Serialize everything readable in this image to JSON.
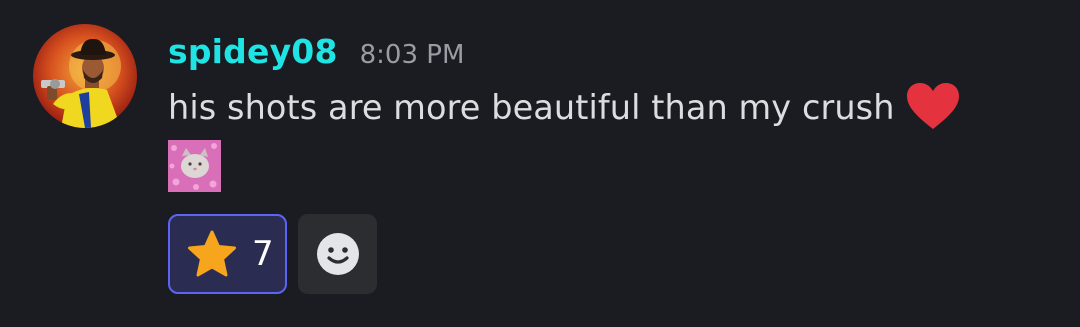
{
  "message": {
    "username": "spidey08",
    "timestamp": "8:03 PM",
    "text": "his shots are more beautiful than my crush",
    "inline_emoji": "red-heart-icon",
    "avatar": "avatar",
    "sticker": "cat-sticker"
  },
  "reactions": [
    {
      "emoji": "star-icon",
      "count": "7",
      "active": true
    }
  ],
  "add_reaction": {
    "icon": "smiley-face-icon"
  },
  "colors": {
    "background": "#1b1c21",
    "username": "#20e3e3",
    "timestamp": "#9a9ca4",
    "message_text": "#dbdee1",
    "reaction_border": "#5c64f4",
    "reaction_bg": "#2a2c52",
    "add_reaction_bg": "#2b2d31"
  }
}
